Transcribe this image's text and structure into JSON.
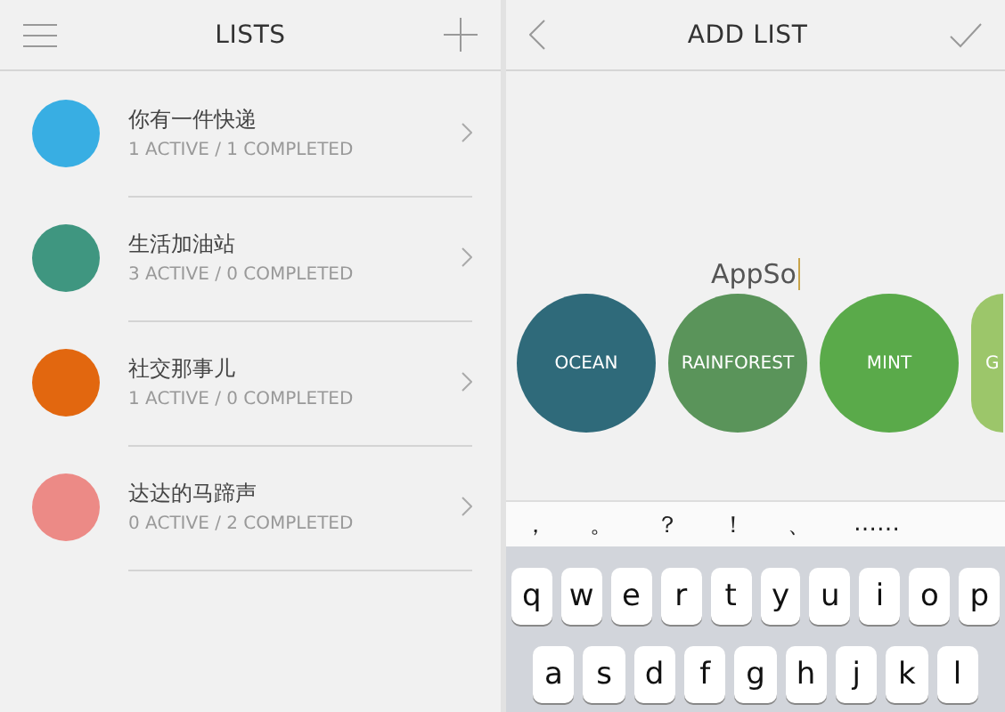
{
  "lists_screen": {
    "title": "LISTS",
    "items": [
      {
        "name": "你有一件快递",
        "summary": "1 ACTIVE / 1 COMPLETED",
        "color": "#38aee3"
      },
      {
        "name": "生活加油站",
        "summary": "3 ACTIVE / 0 COMPLETED",
        "color": "#3f9680"
      },
      {
        "name": "社交那事儿",
        "summary": "1 ACTIVE / 0 COMPLETED",
        "color": "#e2670f"
      },
      {
        "name": "达达的马蹄声",
        "summary": "0 ACTIVE / 2 COMPLETED",
        "color": "#ec8a86"
      }
    ]
  },
  "add_screen": {
    "title": "ADD LIST",
    "name_field": {
      "value": "AppSo"
    },
    "themes": [
      {
        "kind": "full",
        "label": "OCEAN",
        "color": "#2f6a7a"
      },
      {
        "kind": "full",
        "label": "RAINFOREST",
        "color": "#5a945a"
      },
      {
        "kind": "full",
        "label": "MINT",
        "color": "#5aaa4a"
      },
      {
        "kind": "partial",
        "label": "G",
        "color": "#9cc66a"
      }
    ],
    "suggestions": [
      "，",
      "。",
      "？",
      "！",
      "、",
      "……"
    ],
    "keyboard_rows": [
      [
        "q",
        "w",
        "e",
        "r",
        "t",
        "y",
        "u",
        "i",
        "o",
        "p"
      ],
      [
        "a",
        "s",
        "d",
        "f",
        "g",
        "h",
        "j",
        "k",
        "l"
      ]
    ]
  }
}
